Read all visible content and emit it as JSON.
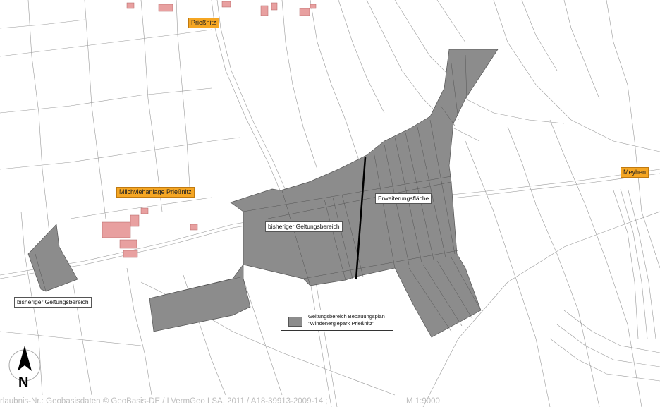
{
  "places": {
    "priessnitz": "Prießnitz",
    "milchvieh": "Milchviehanlage Prießnitz",
    "meyhen": "Meyhen"
  },
  "areas": {
    "bisheriger_mid": "bisheriger Geltungsbereich",
    "bisheriger_left": "bisheriger Geltungsbereich",
    "erweiterung": "Erweiterungsfläche"
  },
  "legend": {
    "line1": "Geltungsbereich Bebauungsplan",
    "line2": "\"Windenergiepark Prießnitz\"",
    "swatch_color": "#8c8c8c"
  },
  "footer": {
    "license": "rlaubnis-Nr.: Geobasisdaten © GeoBasis-DE / LVermGeo LSA, 2011 / A18-39913-2009-14 ;",
    "scale": "M 1:9000"
  },
  "north": {
    "letter": "N"
  },
  "colors": {
    "area_fill": "#8c8c8c",
    "label_bg": "#f5a623",
    "building": "#e8a0a0"
  }
}
